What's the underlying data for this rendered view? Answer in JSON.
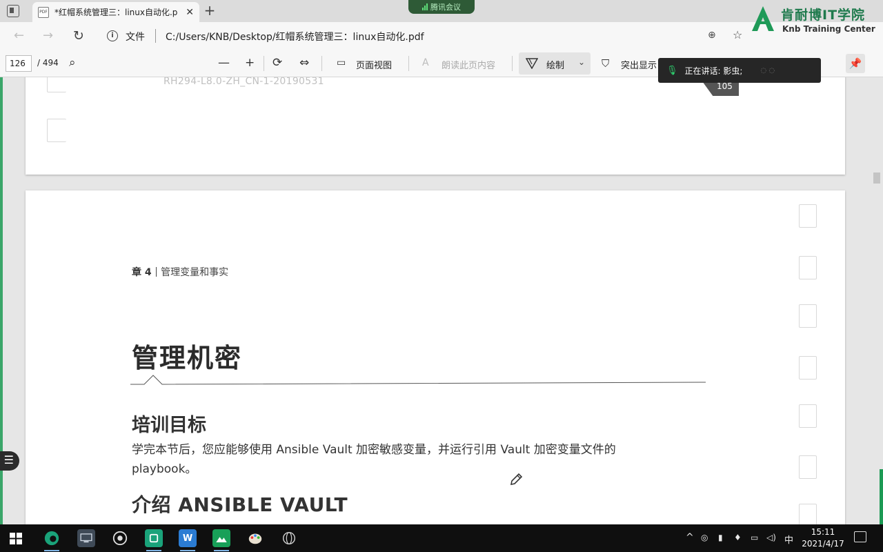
{
  "browser": {
    "tab_title": "*红帽系统管理三：linux自动化.p",
    "tab_icon": "PDF",
    "tab_close": "✕",
    "new_tab": "+",
    "meeting_label": "腾讯会议",
    "back_icon": "←",
    "forward_icon": "→",
    "reload_icon": "↻",
    "info_icon": "i",
    "address_prefix": "文件",
    "address_url": "C:/Users/KNB/Desktop/红帽系统管理三：linux自动化.pdf",
    "zoom_icon": "⊕",
    "star_icon": "☆"
  },
  "logo": {
    "cn": "肯耐博IT学院",
    "en": "Knb Training Center",
    "brand_color": "#1f7a4d"
  },
  "pdf_toolbar": {
    "page_current": "126",
    "page_total": "/ 494",
    "search_icon": "⌕",
    "zoom_out": "—",
    "zoom_in": "+",
    "rotate": "⟳",
    "fit_icon": "⇔",
    "page_view": "页面视图",
    "read_aloud": "朗读此页内容",
    "draw": "绘制",
    "draw_chevron": "⌄",
    "highlight": "突出显示",
    "pin": "📌"
  },
  "speaking": {
    "label": "正在讲话: 影虫;",
    "mic_icon": "🎙",
    "dots": "◌ ◌"
  },
  "prev_page": {
    "code": "RH294-L8.0-ZH_CN-1-20190531",
    "page_number": "105"
  },
  "document": {
    "chapter_num": "章 4",
    "chapter_title": "管理变量和事实",
    "heading": "管理机密",
    "subheading": "培训目标",
    "body": "学完本节后，您应能够使用 Ansible Vault 加密敏感变量，并运行引用 Vault 加密变量文件的 playbook。",
    "subheading2": "介绍 ANSIBLE VAULT"
  },
  "side_button": "☰",
  "taskbar": {
    "start_icon": "⊞",
    "apps": [
      "edge",
      "computer",
      "target",
      "wechat-green",
      "word",
      "photos",
      "paint",
      "globe"
    ],
    "word_label": "W",
    "tray_up": "^",
    "input_method": "中",
    "time": "15:11",
    "date": "2021/4/17",
    "accent": "#7fb5e6"
  }
}
